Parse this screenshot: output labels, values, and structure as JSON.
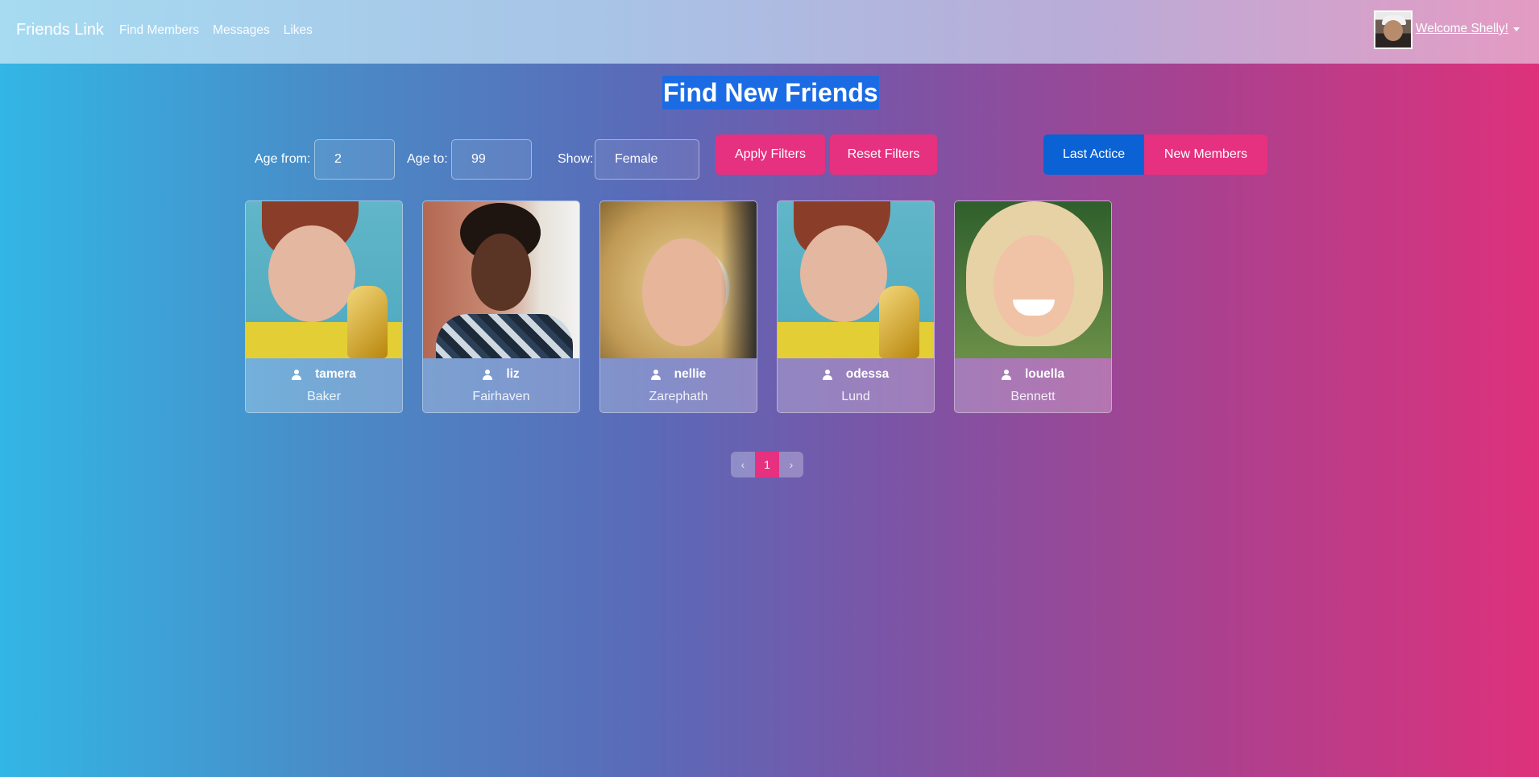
{
  "navbar": {
    "brand": "Friends Link",
    "links": [
      "Find Members",
      "Messages",
      "Likes"
    ],
    "welcome": "Welcome Shelly!"
  },
  "page": {
    "title": "Find New Friends"
  },
  "filters": {
    "age_from_label": "Age from:",
    "age_from_value": "2",
    "age_to_label": "Age to:",
    "age_to_value": "99",
    "show_label": "Show:",
    "show_value": "Female",
    "apply_label": "Apply Filters",
    "reset_label": "Reset Filters"
  },
  "sort": {
    "last_active_label": "Last Actice",
    "new_members_label": "New Members"
  },
  "members": [
    {
      "name": "tamera",
      "city": "Baker"
    },
    {
      "name": "liz",
      "city": "Fairhaven"
    },
    {
      "name": "nellie",
      "city": "Zarephath"
    },
    {
      "name": "odessa",
      "city": "Lund"
    },
    {
      "name": "louella",
      "city": "Bennett"
    }
  ],
  "pagination": {
    "prev": "‹",
    "current": "1",
    "next": "›"
  },
  "colors": {
    "accent_pink": "#e5317f",
    "active_blue": "#0a62d4"
  }
}
